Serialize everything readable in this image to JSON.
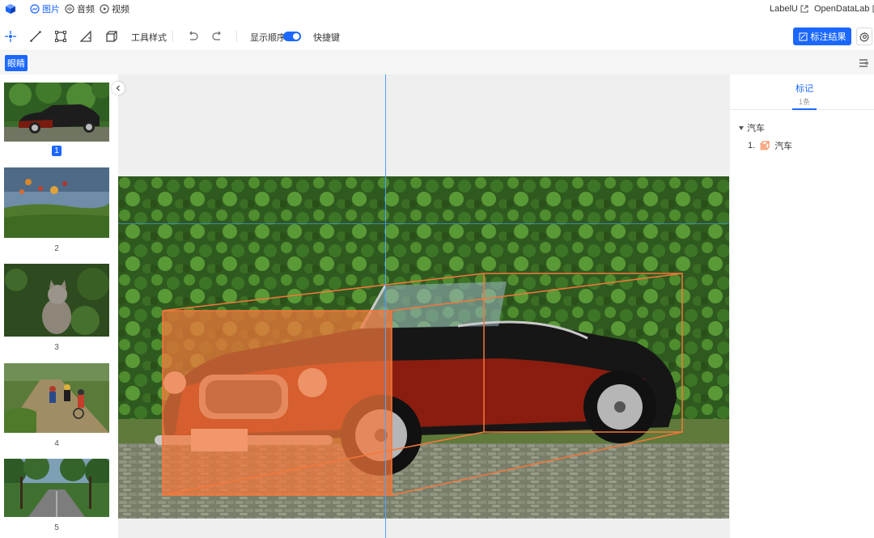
{
  "nav": {
    "tabs": [
      {
        "label": "图片",
        "icon": "image-icon",
        "active": true
      },
      {
        "label": "音频",
        "icon": "audio-icon",
        "active": false
      },
      {
        "label": "视频",
        "icon": "video-icon",
        "active": false
      }
    ],
    "links": [
      {
        "label": "LabelU",
        "icon": "external-link-icon"
      },
      {
        "label": "OpenDataLab",
        "icon": "external-link-icon"
      }
    ]
  },
  "toolbar": {
    "tools": [
      {
        "name": "point-tool",
        "icon": "point-icon",
        "active": true
      },
      {
        "name": "line-tool",
        "icon": "line-icon"
      },
      {
        "name": "rect-tool",
        "icon": "rect-icon"
      },
      {
        "name": "polygon-tool",
        "icon": "polygon-icon"
      },
      {
        "name": "cuboid-tool",
        "icon": "cuboid-icon"
      }
    ],
    "tool_style_label": "工具样式",
    "show_order_label": "显示顺序",
    "show_order_enabled": true,
    "hotkeys_label": "快捷键",
    "result_button_label": "标注结果"
  },
  "attribute_bar": {
    "active_attribute": "眼睛"
  },
  "thumbnails": [
    {
      "index": "1",
      "selected": true
    },
    {
      "index": "2",
      "selected": false
    },
    {
      "index": "3",
      "selected": false
    },
    {
      "index": "4",
      "selected": false
    },
    {
      "index": "5",
      "selected": false
    }
  ],
  "right_panel": {
    "tab_title": "标记",
    "tab_count": "1条",
    "group_name": "汽车",
    "items": [
      {
        "order": "1.",
        "label": "汽车",
        "icon": "cuboid-icon"
      }
    ]
  },
  "colors": {
    "accent": "#1b67ff",
    "annotation": "#f5773a"
  }
}
